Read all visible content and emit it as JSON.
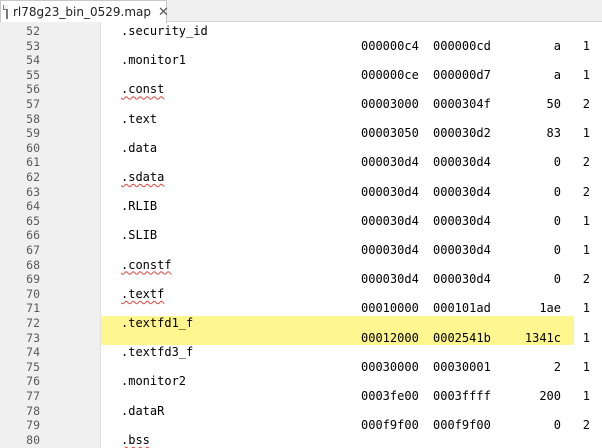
{
  "tab": {
    "title": "rl78g23_bin_0529.map",
    "close_icon": "close-icon",
    "file_icon": "file-icon"
  },
  "lines": [
    {
      "n": "52",
      "section": ".security_id"
    },
    {
      "n": "53",
      "start": "000000c4",
      "end": "000000cd",
      "size": "a",
      "align": "1"
    },
    {
      "n": "54",
      "section": ".monitor1"
    },
    {
      "n": "55",
      "start": "000000ce",
      "end": "000000d7",
      "size": "a",
      "align": "1"
    },
    {
      "n": "56",
      "section": ".const",
      "squiggle": true
    },
    {
      "n": "57",
      "start": "00003000",
      "end": "0000304f",
      "size": "50",
      "align": "2"
    },
    {
      "n": "58",
      "section": ".text"
    },
    {
      "n": "59",
      "start": "00003050",
      "end": "000030d2",
      "size": "83",
      "align": "1"
    },
    {
      "n": "60",
      "section": ".data"
    },
    {
      "n": "61",
      "start": "000030d4",
      "end": "000030d4",
      "size": "0",
      "align": "2"
    },
    {
      "n": "62",
      "section": ".sdata",
      "squiggle": true
    },
    {
      "n": "63",
      "start": "000030d4",
      "end": "000030d4",
      "size": "0",
      "align": "2"
    },
    {
      "n": "64",
      "section": ".RLIB"
    },
    {
      "n": "65",
      "start": "000030d4",
      "end": "000030d4",
      "size": "0",
      "align": "1"
    },
    {
      "n": "66",
      "section": ".SLIB"
    },
    {
      "n": "67",
      "start": "000030d4",
      "end": "000030d4",
      "size": "0",
      "align": "1"
    },
    {
      "n": "68",
      "section": ".constf",
      "squiggle": true
    },
    {
      "n": "69",
      "start": "000030d4",
      "end": "000030d4",
      "size": "0",
      "align": "2"
    },
    {
      "n": "70",
      "section": ".textf",
      "squiggle": true
    },
    {
      "n": "71",
      "start": "00010000",
      "end": "000101ad",
      "size": "1ae",
      "align": "1"
    },
    {
      "n": "72",
      "section": ".textfd1_f",
      "highlight": true
    },
    {
      "n": "73",
      "start": "00012000",
      "end": "0002541b",
      "size": "1341c",
      "align": "1",
      "highlight": true
    },
    {
      "n": "74",
      "section": ".textfd3_f"
    },
    {
      "n": "75",
      "start": "00030000",
      "end": "00030001",
      "size": "2",
      "align": "1"
    },
    {
      "n": "76",
      "section": ".monitor2"
    },
    {
      "n": "77",
      "start": "0003fe00",
      "end": "0003ffff",
      "size": "200",
      "align": "1"
    },
    {
      "n": "78",
      "section": ".dataR"
    },
    {
      "n": "79",
      "start": "000f9f00",
      "end": "000f9f00",
      "size": "0",
      "align": "2"
    },
    {
      "n": "80",
      "section": ".bss",
      "squiggle": true
    }
  ],
  "colors": {
    "highlight": "#fff68f",
    "gutter": "#f0f0f0",
    "squiggle": "#e0443e"
  }
}
